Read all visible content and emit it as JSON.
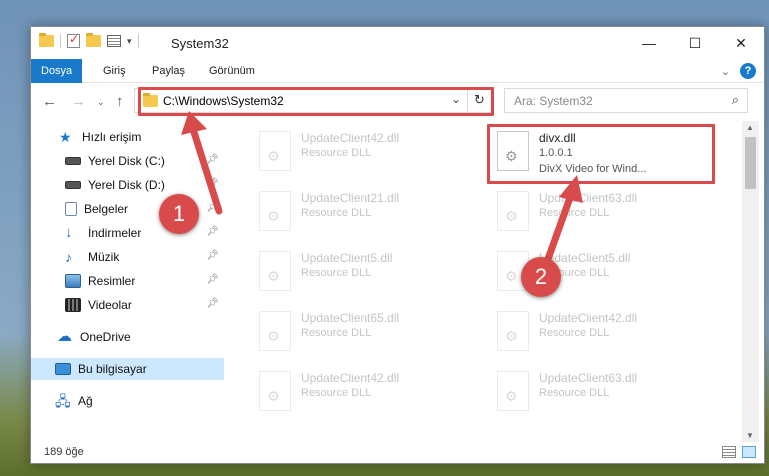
{
  "window": {
    "title": "System32"
  },
  "ribbon": {
    "tabs": [
      {
        "label": "Dosya",
        "active": true
      },
      {
        "label": "Giriş"
      },
      {
        "label": "Paylaş"
      },
      {
        "label": "Görünüm"
      }
    ],
    "help_label": "?"
  },
  "nav": {
    "address": "C:\\Windows\\System32",
    "search_placeholder": "Ara: System32"
  },
  "sidebar": {
    "items": [
      {
        "label": "Hızlı erişim",
        "icon": "star-icon"
      },
      {
        "label": "Yerel Disk (C:)",
        "icon": "drive-icon",
        "pinned": true
      },
      {
        "label": "Yerel Disk (D:)",
        "icon": "drive-icon",
        "pinned": true
      },
      {
        "label": "Belgeler",
        "icon": "documents-icon",
        "pinned": true
      },
      {
        "label": "İndirmeler",
        "icon": "download-icon",
        "pinned": true
      },
      {
        "label": "Müzik",
        "icon": "music-icon",
        "pinned": true
      },
      {
        "label": "Resimler",
        "icon": "pictures-icon",
        "pinned": true
      },
      {
        "label": "Videolar",
        "icon": "videos-icon",
        "pinned": true
      },
      {
        "label": "OneDrive",
        "icon": "cloud-icon"
      },
      {
        "label": "Bu bilgisayar",
        "icon": "computer-icon",
        "selected": true
      },
      {
        "label": "Ağ",
        "icon": "network-icon"
      }
    ]
  },
  "files": [
    {
      "name": "UpdateClient42.dll",
      "desc": "Resource DLL"
    },
    {
      "name": "divx.dll",
      "version": "1.0.0.1",
      "desc": "DivX Video for Wind...",
      "highlighted": true
    },
    {
      "name": "UpdateClient21.dll",
      "desc": "Resource DLL"
    },
    {
      "name": "UpdateClient63.dll",
      "desc": "Resource DLL"
    },
    {
      "name": "UpdateClient5.dll",
      "desc": "Resource DLL"
    },
    {
      "name": "UpdateClient5.dll",
      "desc": "Resource DLL"
    },
    {
      "name": "UpdateClient65.dll",
      "desc": "Resource DLL"
    },
    {
      "name": "UpdateClient42.dll",
      "desc": "Resource DLL"
    },
    {
      "name": "UpdateClient42.dll",
      "desc": "Resource DLL"
    },
    {
      "name": "UpdateClient63.dll",
      "desc": "Resource DLL"
    }
  ],
  "status": {
    "count": "189 öğe"
  },
  "callouts": [
    {
      "label": "1"
    },
    {
      "label": "2"
    }
  ],
  "colors": {
    "accent": "#1979ca",
    "callout": "#d94b4b",
    "selection": "#cce8ff"
  }
}
